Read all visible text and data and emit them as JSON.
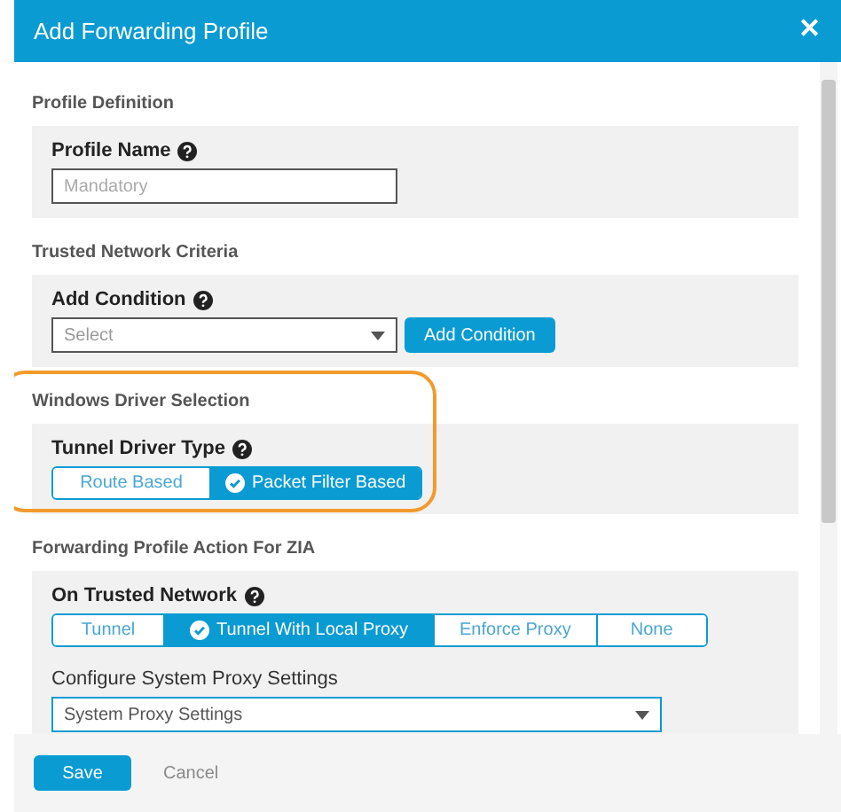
{
  "dialog": {
    "title": "Add Forwarding Profile",
    "close": "✕"
  },
  "sections": [
    {
      "title": "Profile Definition",
      "highlighted": false,
      "fields": [
        {
          "kind": "input",
          "label": "Profile Name",
          "help": true,
          "placeholder": "Mandatory"
        }
      ]
    },
    {
      "title": "Trusted Network Criteria",
      "highlighted": false,
      "fields": [
        {
          "kind": "select_button",
          "label": "Add Condition",
          "help": true,
          "placeholder": "Select",
          "button": "Add Condition"
        }
      ]
    },
    {
      "title": "Windows Driver Selection",
      "highlighted": true,
      "fields": [
        {
          "kind": "segmented",
          "label": "Tunnel Driver Type",
          "help": true,
          "options": [
            {
              "label": "Route Based",
              "selected": false
            },
            {
              "label": "Packet Filter Based",
              "selected": true
            }
          ]
        }
      ]
    },
    {
      "title": "Forwarding Profile Action For ZIA",
      "highlighted": false,
      "fields": [
        {
          "kind": "segmented",
          "label": "On Trusted Network",
          "help": true,
          "options": [
            {
              "label": "Tunnel",
              "selected": false
            },
            {
              "label": "Tunnel With Local Proxy",
              "selected": true
            },
            {
              "label": "Enforce Proxy",
              "selected": false
            },
            {
              "label": "None",
              "selected": false
            }
          ]
        },
        {
          "kind": "select",
          "label": "Configure System Proxy Settings",
          "help": false,
          "value": "System Proxy Settings"
        }
      ]
    }
  ],
  "footer": {
    "buttons": [
      {
        "label": "Save",
        "kind": "primary"
      },
      {
        "label": "Cancel",
        "kind": "link"
      }
    ]
  }
}
